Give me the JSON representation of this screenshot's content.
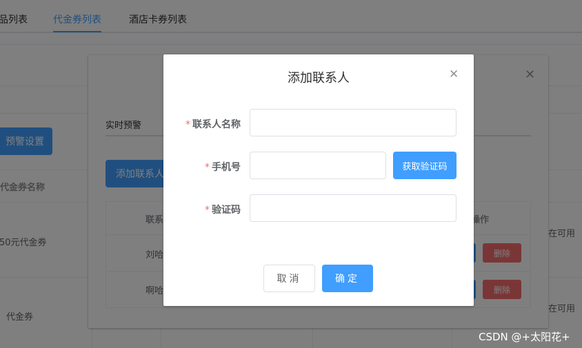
{
  "tabs": [
    {
      "label": "品列表"
    },
    {
      "label": "代金券列表"
    },
    {
      "label": "酒店卡券列表"
    }
  ],
  "page": {
    "warning_settings_button": "预警设置",
    "column_voucher_name": "代金券名称",
    "rows": [
      {
        "name": "50元代金券",
        "status": "在可用"
      },
      {
        "name": "代金券",
        "status": "在可用"
      }
    ]
  },
  "outer_dialog": {
    "tab_label": "实时预警",
    "add_contact_button": "添加联系人",
    "table": {
      "col_contact": "联系",
      "col_actions": "操作",
      "rows": [
        {
          "contact": "刘哈",
          "delete_label": "删除"
        },
        {
          "contact": "啊哈",
          "delete_label": "删除"
        }
      ]
    }
  },
  "modal": {
    "title": "添加联系人",
    "required_mark": "*",
    "fields": {
      "name_label": "联系人名称",
      "name_value": "",
      "phone_label": "手机号",
      "phone_value": "",
      "code_label": "验证码",
      "code_value": ""
    },
    "get_code_button": "获取验证码",
    "cancel_button": "取消",
    "confirm_button": "确定"
  },
  "watermark": "CSDN @+太阳花+",
  "colors": {
    "primary": "#409eff",
    "danger": "#f56c6c",
    "required": "#f56c6c"
  },
  "icons": {
    "modal_close": "close-icon",
    "outer_close": "close-icon"
  }
}
